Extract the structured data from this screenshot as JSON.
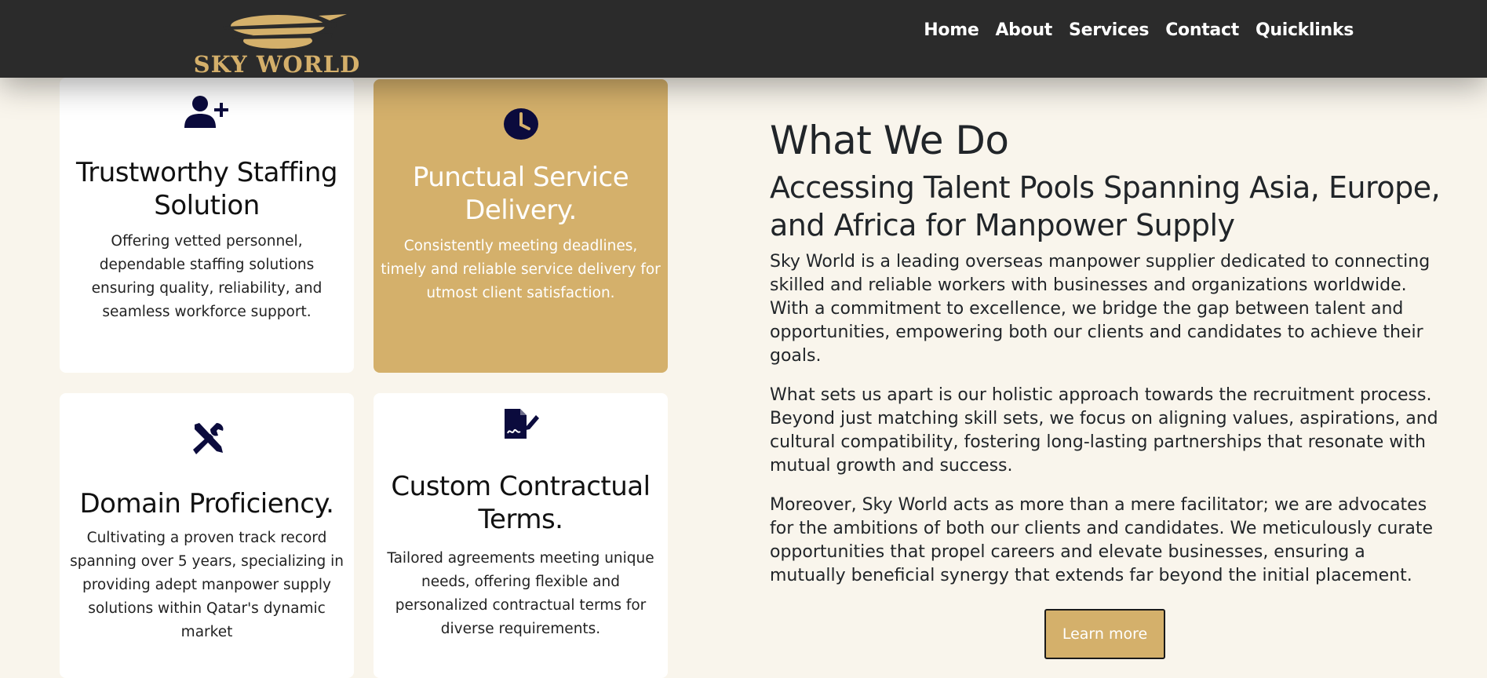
{
  "brand": {
    "logo_text": "SKY WORLD",
    "gold": "#d4b06b",
    "navy": "#0b0b3d",
    "nav_bg": "#2b2b2b"
  },
  "nav": {
    "items": [
      {
        "label": "Home"
      },
      {
        "label": "About"
      },
      {
        "label": "Services"
      },
      {
        "label": "Contact"
      },
      {
        "label": "Quicklinks"
      }
    ]
  },
  "features": [
    {
      "icon": "user-plus-icon",
      "title": "Trustworthy Staffing Solution",
      "text": "Offering vetted personnel, dependable staffing solutions ensuring quality, reliability, and seamless workforce support."
    },
    {
      "icon": "clock-icon",
      "title": "Punctual Service Delivery.",
      "text": "Consistently meeting deadlines, timely and reliable service delivery for utmost client satisfaction."
    },
    {
      "icon": "tools-icon",
      "title": "Domain Proficiency.",
      "text": "Cultivating a proven track record spanning over 5 years, specializing in providing adept manpower supply solutions within Qatar's dynamic market"
    },
    {
      "icon": "file-signature-icon",
      "title": "Custom Contractual Terms.",
      "text": "Tailored agreements meeting unique needs, offering flexible and personalized contractual terms for diverse requirements."
    }
  ],
  "about": {
    "title": "What We Do",
    "subtitle": "Accessing Talent Pools Spanning Asia, Europe, and Africa for Manpower Supply",
    "paragraphs": [
      "Sky World is a leading overseas manpower supplier dedicated to connecting skilled and reliable workers with businesses and organizations worldwide. With a commitment to excellence, we bridge the gap between talent and opportunities, empowering both our clients and candidates to achieve their goals.",
      "What sets us apart is our holistic approach towards the recruitment process. Beyond just matching skill sets, we focus on aligning values, aspirations, and cultural compatibility, fostering long-lasting partnerships that resonate with mutual growth and success.",
      "Moreover, Sky World acts as more than a mere facilitator; we are advocates for the ambitions of both our clients and candidates. We meticulously curate opportunities that propel careers and elevate businesses, ensuring a mutually beneficial synergy that extends far beyond the initial placement."
    ],
    "button_label": "Learn more"
  }
}
